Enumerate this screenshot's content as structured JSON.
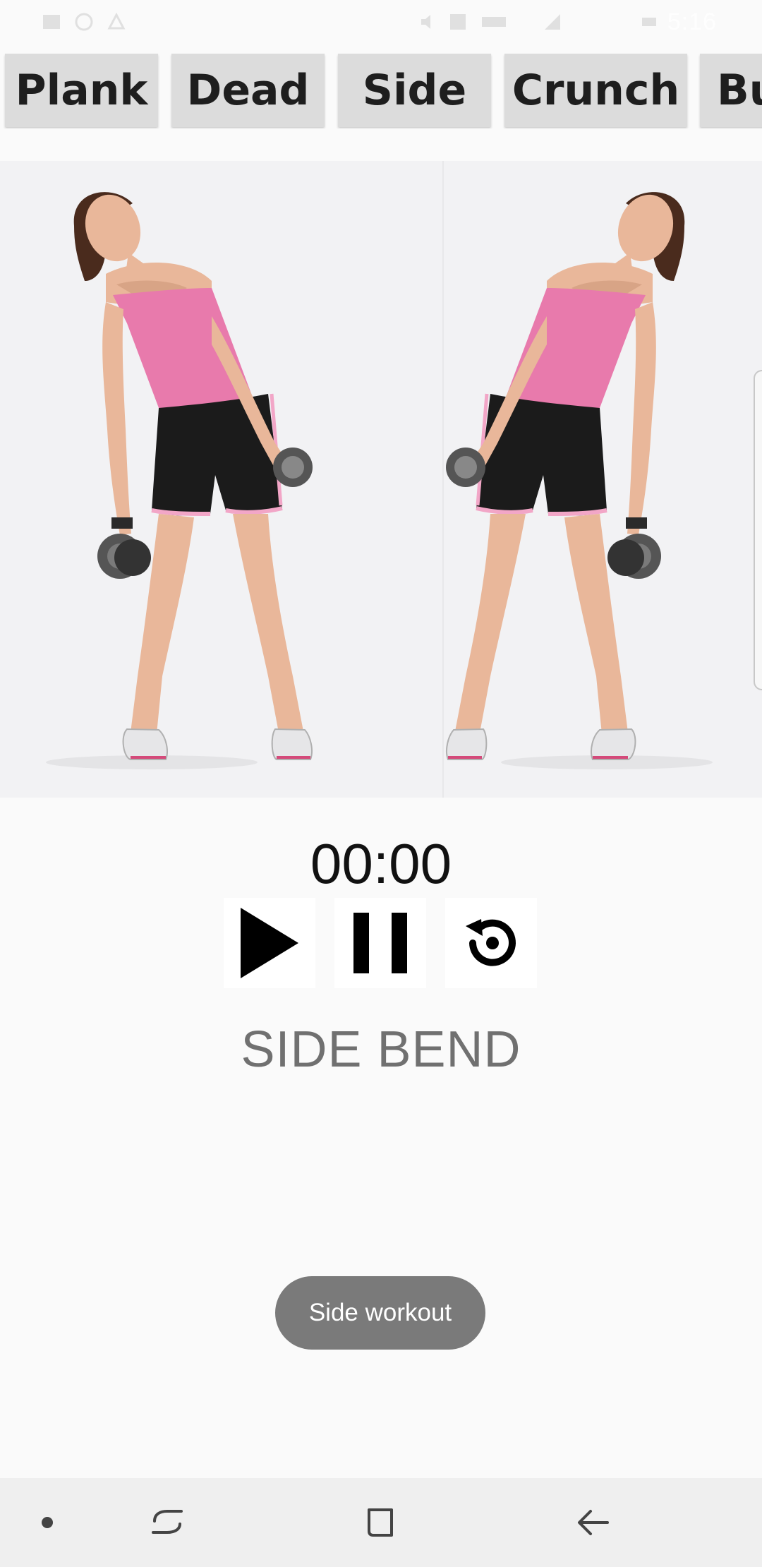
{
  "status_bar": {
    "time": "5:16",
    "icons": [
      "gallery-icon",
      "sync-icon",
      "alarm-icon",
      "mute-icon",
      "nfc-icon",
      "lte-icon",
      "signal-icon",
      "battery-icon"
    ]
  },
  "exercise_tabs": [
    {
      "label": "Plank"
    },
    {
      "label": "Dead"
    },
    {
      "label": "Side"
    },
    {
      "label": "Crunch"
    },
    {
      "label": "Bu"
    }
  ],
  "illustration": {
    "colors": {
      "top": "#e87aac",
      "shorts": "#1b1b1b",
      "skin": "#e9b79a",
      "hair": "#4a2b1d",
      "dumbbell": "#555555"
    }
  },
  "timer": {
    "display": "00:00"
  },
  "controls": {
    "play_icon": "play-icon",
    "pause_icon": "pause-icon",
    "reset_icon": "reset-icon"
  },
  "exercise": {
    "title": "SIDE BEND"
  },
  "toast": {
    "message": "Side workout"
  },
  "nav_bar": {
    "icons": [
      "dot-icon",
      "recents-icon",
      "home-icon",
      "back-icon"
    ]
  }
}
